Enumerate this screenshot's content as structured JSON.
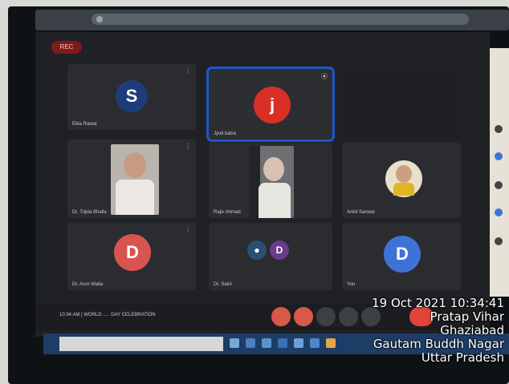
{
  "recording_badge": "REC",
  "participants": [
    {
      "initial": "S",
      "name": "Ekta Rawat",
      "color": "#1f3c7a"
    },
    {
      "initial": "j",
      "name": "Jyoti batra",
      "color": "#d93025"
    },
    {
      "initial": "",
      "name": "Dr. Tripta Bhalla",
      "color": ""
    },
    {
      "initial": "",
      "name": "Rajiv Ahmad",
      "color": ""
    },
    {
      "initial": "",
      "name": "Ankit Sanwal",
      "color": ""
    },
    {
      "initial": "D",
      "name": "Dr. Arun Walia",
      "color": "#d9534f"
    },
    {
      "initial": "D",
      "name": "Dr. Saini",
      "color": "#6a3c8c"
    },
    {
      "initial": "D",
      "name": "You",
      "color": "#3d73d6"
    }
  ],
  "meeting_bar": {
    "time": "10:34 AM",
    "separator": "|",
    "meeting_title": "WORLD ..... DAY CELEBRATION"
  },
  "stamp": {
    "datetime": "19 Oct 2021 10:34:41",
    "line1": "Pratap Vihar",
    "line2": "Ghaziabad",
    "line3": "Gautam Buddh Nagar",
    "line4": "Uttar Pradesh"
  },
  "icons": [
    "mic-icon",
    "camera-icon",
    "hand-icon",
    "present-icon",
    "more-icon",
    "end-call-icon"
  ]
}
